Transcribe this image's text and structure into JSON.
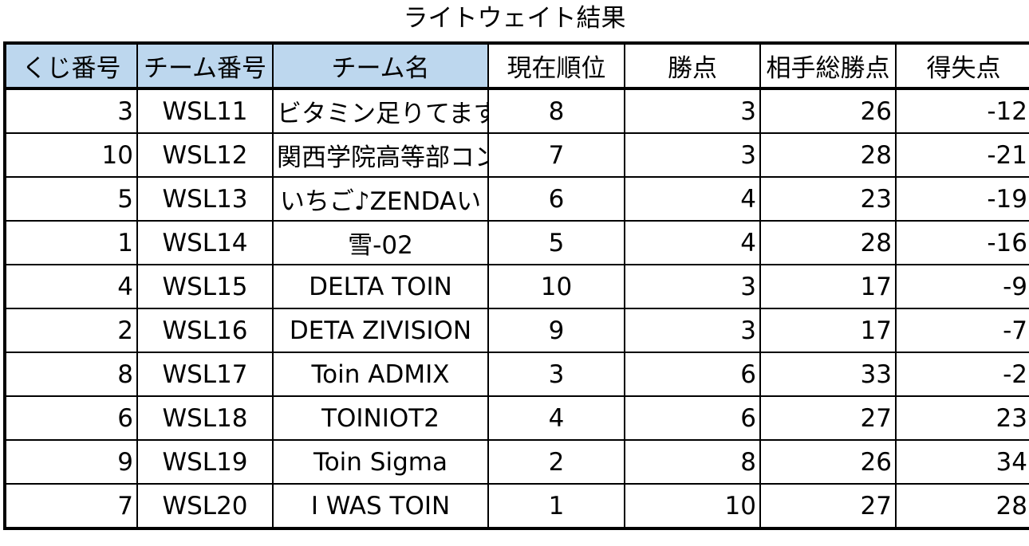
{
  "title": "ライトウェイト結果",
  "colors": {
    "header_highlight": "#bdd7ee",
    "border": "#000000"
  },
  "table": {
    "headers": [
      "くじ番号",
      "チーム番号",
      "チーム名",
      "現在順位",
      "勝点",
      "相手総勝点",
      "得失点"
    ],
    "rows": [
      [
        "3",
        "WSL11",
        "ビタミン足りてますか",
        "8",
        "3",
        "26",
        "-12"
      ],
      [
        "10",
        "WSL12",
        "関西学院高等部コンピュータ部ロボット班",
        "7",
        "3",
        "28",
        "-21"
      ],
      [
        "5",
        "WSL13",
        "いちご♪ZENDAい",
        "6",
        "4",
        "23",
        "-19"
      ],
      [
        "1",
        "WSL14",
        "雪-02",
        "5",
        "4",
        "28",
        "-16"
      ],
      [
        "4",
        "WSL15",
        "DELTA TOIN",
        "10",
        "3",
        "17",
        "-9"
      ],
      [
        "2",
        "WSL16",
        "DETA ZIVISION",
        "9",
        "3",
        "17",
        "-7"
      ],
      [
        "8",
        "WSL17",
        "Toin ADMIX",
        "3",
        "6",
        "33",
        "-2"
      ],
      [
        "6",
        "WSL18",
        "TOINIOT2",
        "4",
        "6",
        "27",
        "23"
      ],
      [
        "9",
        "WSL19",
        "Toin Sigma",
        "2",
        "8",
        "26",
        "34"
      ],
      [
        "7",
        "WSL20",
        "I WAS TOIN",
        "1",
        "10",
        "27",
        "28"
      ]
    ]
  }
}
